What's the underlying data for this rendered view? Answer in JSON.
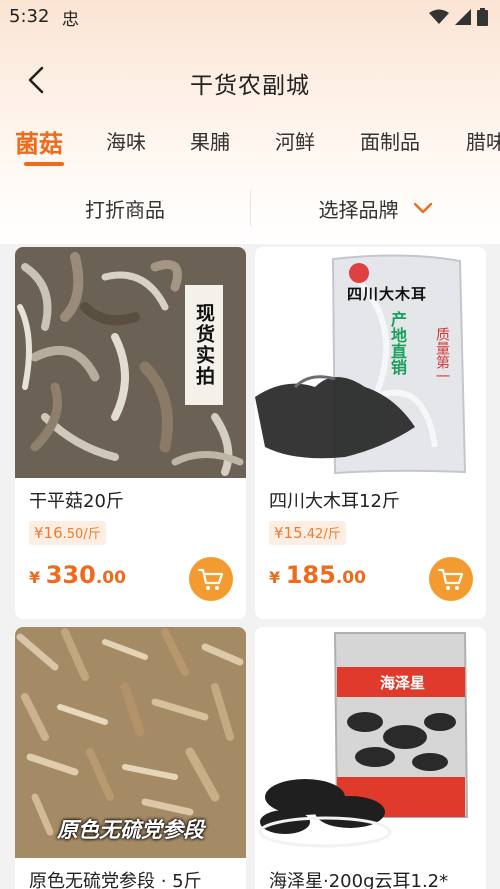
{
  "status": {
    "time": "5:32",
    "app_glyph": "忠"
  },
  "header": {
    "title": "干货农副城",
    "back_icon": "chevron-left-icon"
  },
  "tabs": [
    {
      "label": "菌菇",
      "active": true
    },
    {
      "label": "海味"
    },
    {
      "label": "果脯"
    },
    {
      "label": "河鲜"
    },
    {
      "label": "面制品"
    },
    {
      "label": "腊味"
    }
  ],
  "filters": {
    "discount_label": "打折商品",
    "brand_label": "选择品牌"
  },
  "products": [
    {
      "name": "干平菇20斤",
      "unit_price_prefix": "¥16",
      "unit_price_suffix": ".50/斤",
      "price_yen": "¥",
      "price_int": "330",
      "price_dec": ".00",
      "image_badge": "现货实拍"
    },
    {
      "name": "四川大木耳12斤",
      "unit_price_prefix": "¥15",
      "unit_price_suffix": ".42/斤",
      "price_yen": "¥",
      "price_int": "185",
      "price_dec": ".00",
      "image_bag_text": "四川大木耳",
      "image_bag_sub": "产地直销",
      "image_bag_side": "质量第一"
    },
    {
      "name": "原色无硫党参段 · 5斤",
      "image_caption": "原色无硫党参段"
    },
    {
      "name": "海泽星·200g云耳1.2*",
      "image_brand": "海泽星"
    }
  ],
  "colors": {
    "accent": "#f06a1c",
    "cart_button": "#f39a30",
    "unit_price_bg": "#fdeee4"
  }
}
